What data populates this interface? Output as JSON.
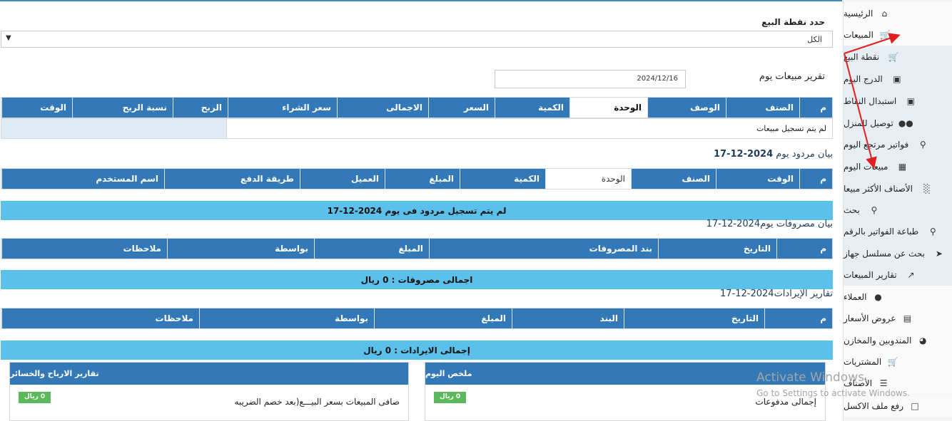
{
  "sidebar": {
    "home": "الرئيسية",
    "sales": "المبيعات",
    "sub": [
      "نقطة البيع",
      "الدرج اليوم",
      "استبدال النقاط",
      "توصيل للمنزل",
      "فواتير مرتجع اليوم",
      "مبيعات اليوم",
      "الأصناف الأكثر مبيعا",
      "بحث",
      "طباعة الفواتير بالرقم",
      "بحث عن مسلسل جهاز",
      "تقارير المبيعات"
    ],
    "main2": [
      "العملاء",
      "عروض الأسعار",
      "المندوبين والمخازن",
      "المشتريات",
      "الأصناف",
      "رفع ملف الاكسل"
    ]
  },
  "pos": {
    "label": "حدد نقطة البيع",
    "value": "الكل"
  },
  "report": {
    "label": "تقرير مبيعات يوم",
    "date": "2024/12/16"
  },
  "sales_table": {
    "headers": [
      "م",
      "الصنف",
      "الوصف",
      "الوحدة",
      "الكمية",
      "السعر",
      "الاجمالى",
      "سعر الشراء",
      "الربح",
      "نسبة الربح",
      "الوقت"
    ],
    "empty": "لم يتم تسجيل مبيعات"
  },
  "returns": {
    "title_prefix": "بيان مردود يوم",
    "title_date": "2024-12-17",
    "headers": [
      "م",
      "الوقت",
      "الصنف",
      "الوحدة",
      "الكمية",
      "المبلغ",
      "العميل",
      "طريقة الدفع",
      "اسم المستخدم"
    ],
    "empty": "لم يتم تسجيل مردود فى يوم 2024-12-17"
  },
  "expenses": {
    "title": "بيان مصروفات يوم2024-12-17",
    "headers": [
      "م",
      "التاريخ",
      "بند المصروفات",
      "المبلغ",
      "بواسطة",
      "ملاحظات"
    ],
    "total": "اجمالى مصروفات : 0 ريال"
  },
  "revenues": {
    "title": "تقارير الإيرادات2024-12-17",
    "headers": [
      "م",
      "التاريخ",
      "البند",
      "المبلغ",
      "بواسطة",
      "ملاحظات"
    ],
    "total": "إجمالى الايرادات : 0 ريال"
  },
  "summary": {
    "title": "ملخص اليوم",
    "row_label": "إجمالى مدفوعات",
    "badge": "0 ريال"
  },
  "profits": {
    "title": "تقارير الارباح والخسائر",
    "row_label": "صافى المبيعات بسعر البيـــع(بعد خصم الضريبه",
    "badge": "0 ريال"
  },
  "watermark": {
    "line1": "Activate Windows",
    "line2": "Go to Settings to activate Windows."
  },
  "colors": {
    "header_blue": "#3479b7",
    "bar_cyan": "#5bc0ea",
    "badge_green": "#5cb85c",
    "arrow_red": "#e02020"
  }
}
